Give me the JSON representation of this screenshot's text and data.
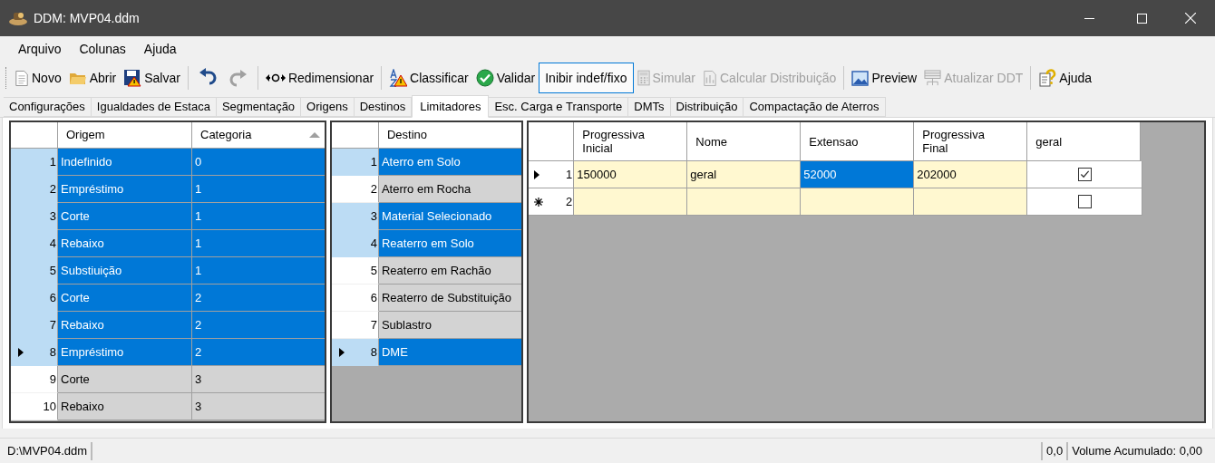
{
  "window": {
    "title": "DDM: MVP04.ddm"
  },
  "menu": [
    "Arquivo",
    "Colunas",
    "Ajuda"
  ],
  "toolbar": [
    {
      "kind": "button",
      "label": "Novo",
      "disabled": false
    },
    {
      "kind": "button",
      "label": "Abrir",
      "disabled": false
    },
    {
      "kind": "button",
      "label": "Salvar",
      "disabled": false
    },
    {
      "kind": "separator"
    },
    {
      "kind": "icon",
      "disabled": false
    },
    {
      "kind": "icon",
      "disabled": true
    },
    {
      "kind": "separator"
    },
    {
      "kind": "button",
      "label": "Redimensionar",
      "disabled": false
    },
    {
      "kind": "separator"
    },
    {
      "kind": "button",
      "label": "Classificar",
      "disabled": false
    },
    {
      "kind": "button",
      "label": "Validar",
      "disabled": false
    },
    {
      "kind": "toggle",
      "label": "Inibir indef/fixo",
      "disabled": false,
      "focused": true
    },
    {
      "kind": "button",
      "label": "Simular",
      "disabled": true
    },
    {
      "kind": "button",
      "label": "Calcular Distribuição",
      "disabled": true
    },
    {
      "kind": "separator"
    },
    {
      "kind": "button",
      "label": "Preview",
      "disabled": false
    },
    {
      "kind": "button",
      "label": "Atualizar DDT",
      "disabled": true
    },
    {
      "kind": "separator"
    },
    {
      "kind": "button",
      "label": "Ajuda",
      "disabled": false
    }
  ],
  "tabs": [
    {
      "label": "Configurações",
      "selected": false
    },
    {
      "label": "Igualdades de Estaca",
      "selected": false
    },
    {
      "label": "Segmentação",
      "selected": false
    },
    {
      "label": "Origens",
      "selected": false
    },
    {
      "label": "Destinos",
      "selected": false
    },
    {
      "label": "Limitadores",
      "selected": true
    },
    {
      "label": "Esc. Carga e Transporte",
      "selected": false
    },
    {
      "label": "DMTs",
      "selected": false
    },
    {
      "label": "Distribuição",
      "selected": false
    },
    {
      "label": "Compactação de Aterros",
      "selected": false
    }
  ],
  "origens_grid": {
    "columns": [
      {
        "label": "Origem",
        "sorted": false
      },
      {
        "label": "Categoria",
        "sorted": true
      }
    ],
    "rows": [
      {
        "number": "1",
        "cells": [
          "Indefinido",
          "0"
        ],
        "selected": true,
        "current": false
      },
      {
        "number": "2",
        "cells": [
          "Empréstimo",
          "1"
        ],
        "selected": true,
        "current": false
      },
      {
        "number": "3",
        "cells": [
          "Corte",
          "1"
        ],
        "selected": true,
        "current": false
      },
      {
        "number": "4",
        "cells": [
          "Rebaixo",
          "1"
        ],
        "selected": true,
        "current": false
      },
      {
        "number": "5",
        "cells": [
          "Substiuição",
          "1"
        ],
        "selected": true,
        "current": false
      },
      {
        "number": "6",
        "cells": [
          "Corte",
          "2"
        ],
        "selected": true,
        "current": false
      },
      {
        "number": "7",
        "cells": [
          "Rebaixo",
          "2"
        ],
        "selected": true,
        "current": false
      },
      {
        "number": "8",
        "cells": [
          "Empréstimo",
          "2"
        ],
        "selected": true,
        "current": true
      },
      {
        "number": "9",
        "cells": [
          "Corte",
          "3"
        ],
        "selected": false,
        "current": false
      },
      {
        "number": "10",
        "cells": [
          "Rebaixo",
          "3"
        ],
        "selected": false,
        "current": false
      }
    ]
  },
  "destinos_grid": {
    "columns": [
      {
        "label": "Destino",
        "sorted": false
      }
    ],
    "rows": [
      {
        "number": "1",
        "cells": [
          "Aterro em Solo"
        ],
        "selected": true,
        "current": false
      },
      {
        "number": "2",
        "cells": [
          "Aterro em Rocha"
        ],
        "selected": false,
        "current": false
      },
      {
        "number": "3",
        "cells": [
          "Material Selecionado"
        ],
        "selected": true,
        "current": false
      },
      {
        "number": "4",
        "cells": [
          "Reaterro em Solo"
        ],
        "selected": true,
        "current": false
      },
      {
        "number": "5",
        "cells": [
          "Reaterro em Rachão"
        ],
        "selected": false,
        "current": false
      },
      {
        "number": "6",
        "cells": [
          "Reaterro de Substituição"
        ],
        "selected": false,
        "current": false
      },
      {
        "number": "7",
        "cells": [
          "Sublastro"
        ],
        "selected": false,
        "current": false
      },
      {
        "number": "8",
        "cells": [
          "DME"
        ],
        "selected": true,
        "current": true
      }
    ]
  },
  "limitadores_grid": {
    "columns": [
      "Progressiva\nInicial",
      "Nome",
      "Extensao",
      "Progressiva\nFinal",
      "geral"
    ],
    "rows": [
      {
        "number": "1",
        "current": true,
        "new_row": false,
        "cells": [
          {
            "text": "150000",
            "selected": false
          },
          {
            "text": "geral",
            "selected": false
          },
          {
            "text": "52000",
            "selected": true
          },
          {
            "text": "202000",
            "selected": false
          }
        ],
        "checked": true
      },
      {
        "number": "2",
        "current": false,
        "new_row": true,
        "cells": [
          {
            "selected": false
          },
          {
            "selected": false
          },
          {
            "selected": false
          },
          {
            "selected": false
          }
        ],
        "checked": false
      }
    ]
  },
  "status_bar": {
    "file": "D:\\MVP04.ddm",
    "value": "0,0",
    "volume": "Volume Acumulado: 0,00"
  }
}
